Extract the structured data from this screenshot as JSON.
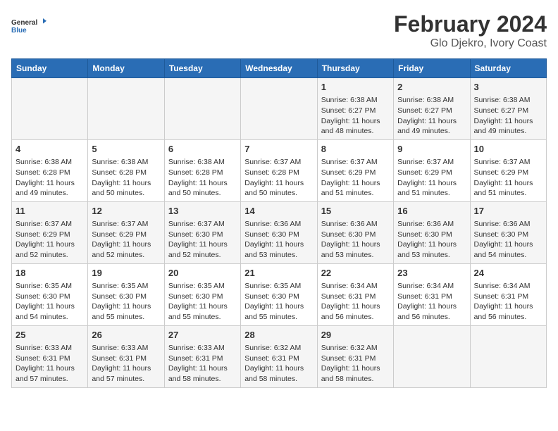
{
  "header": {
    "logo_line1": "General",
    "logo_line2": "Blue",
    "title": "February 2024",
    "subtitle": "Glo Djekro, Ivory Coast"
  },
  "days_of_week": [
    "Sunday",
    "Monday",
    "Tuesday",
    "Wednesday",
    "Thursday",
    "Friday",
    "Saturday"
  ],
  "weeks": [
    [
      {
        "day": "",
        "info": ""
      },
      {
        "day": "",
        "info": ""
      },
      {
        "day": "",
        "info": ""
      },
      {
        "day": "",
        "info": ""
      },
      {
        "day": "1",
        "info": "Sunrise: 6:38 AM\nSunset: 6:27 PM\nDaylight: 11 hours\nand 48 minutes."
      },
      {
        "day": "2",
        "info": "Sunrise: 6:38 AM\nSunset: 6:27 PM\nDaylight: 11 hours\nand 49 minutes."
      },
      {
        "day": "3",
        "info": "Sunrise: 6:38 AM\nSunset: 6:27 PM\nDaylight: 11 hours\nand 49 minutes."
      }
    ],
    [
      {
        "day": "4",
        "info": "Sunrise: 6:38 AM\nSunset: 6:28 PM\nDaylight: 11 hours\nand 49 minutes."
      },
      {
        "day": "5",
        "info": "Sunrise: 6:38 AM\nSunset: 6:28 PM\nDaylight: 11 hours\nand 50 minutes."
      },
      {
        "day": "6",
        "info": "Sunrise: 6:38 AM\nSunset: 6:28 PM\nDaylight: 11 hours\nand 50 minutes."
      },
      {
        "day": "7",
        "info": "Sunrise: 6:37 AM\nSunset: 6:28 PM\nDaylight: 11 hours\nand 50 minutes."
      },
      {
        "day": "8",
        "info": "Sunrise: 6:37 AM\nSunset: 6:29 PM\nDaylight: 11 hours\nand 51 minutes."
      },
      {
        "day": "9",
        "info": "Sunrise: 6:37 AM\nSunset: 6:29 PM\nDaylight: 11 hours\nand 51 minutes."
      },
      {
        "day": "10",
        "info": "Sunrise: 6:37 AM\nSunset: 6:29 PM\nDaylight: 11 hours\nand 51 minutes."
      }
    ],
    [
      {
        "day": "11",
        "info": "Sunrise: 6:37 AM\nSunset: 6:29 PM\nDaylight: 11 hours\nand 52 minutes."
      },
      {
        "day": "12",
        "info": "Sunrise: 6:37 AM\nSunset: 6:29 PM\nDaylight: 11 hours\nand 52 minutes."
      },
      {
        "day": "13",
        "info": "Sunrise: 6:37 AM\nSunset: 6:30 PM\nDaylight: 11 hours\nand 52 minutes."
      },
      {
        "day": "14",
        "info": "Sunrise: 6:36 AM\nSunset: 6:30 PM\nDaylight: 11 hours\nand 53 minutes."
      },
      {
        "day": "15",
        "info": "Sunrise: 6:36 AM\nSunset: 6:30 PM\nDaylight: 11 hours\nand 53 minutes."
      },
      {
        "day": "16",
        "info": "Sunrise: 6:36 AM\nSunset: 6:30 PM\nDaylight: 11 hours\nand 53 minutes."
      },
      {
        "day": "17",
        "info": "Sunrise: 6:36 AM\nSunset: 6:30 PM\nDaylight: 11 hours\nand 54 minutes."
      }
    ],
    [
      {
        "day": "18",
        "info": "Sunrise: 6:35 AM\nSunset: 6:30 PM\nDaylight: 11 hours\nand 54 minutes."
      },
      {
        "day": "19",
        "info": "Sunrise: 6:35 AM\nSunset: 6:30 PM\nDaylight: 11 hours\nand 55 minutes."
      },
      {
        "day": "20",
        "info": "Sunrise: 6:35 AM\nSunset: 6:30 PM\nDaylight: 11 hours\nand 55 minutes."
      },
      {
        "day": "21",
        "info": "Sunrise: 6:35 AM\nSunset: 6:30 PM\nDaylight: 11 hours\nand 55 minutes."
      },
      {
        "day": "22",
        "info": "Sunrise: 6:34 AM\nSunset: 6:31 PM\nDaylight: 11 hours\nand 56 minutes."
      },
      {
        "day": "23",
        "info": "Sunrise: 6:34 AM\nSunset: 6:31 PM\nDaylight: 11 hours\nand 56 minutes."
      },
      {
        "day": "24",
        "info": "Sunrise: 6:34 AM\nSunset: 6:31 PM\nDaylight: 11 hours\nand 56 minutes."
      }
    ],
    [
      {
        "day": "25",
        "info": "Sunrise: 6:33 AM\nSunset: 6:31 PM\nDaylight: 11 hours\nand 57 minutes."
      },
      {
        "day": "26",
        "info": "Sunrise: 6:33 AM\nSunset: 6:31 PM\nDaylight: 11 hours\nand 57 minutes."
      },
      {
        "day": "27",
        "info": "Sunrise: 6:33 AM\nSunset: 6:31 PM\nDaylight: 11 hours\nand 58 minutes."
      },
      {
        "day": "28",
        "info": "Sunrise: 6:32 AM\nSunset: 6:31 PM\nDaylight: 11 hours\nand 58 minutes."
      },
      {
        "day": "29",
        "info": "Sunrise: 6:32 AM\nSunset: 6:31 PM\nDaylight: 11 hours\nand 58 minutes."
      },
      {
        "day": "",
        "info": ""
      },
      {
        "day": "",
        "info": ""
      }
    ]
  ]
}
